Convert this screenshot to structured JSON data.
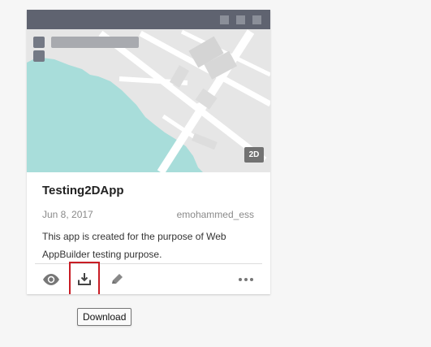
{
  "card": {
    "title": "Testing2DApp",
    "date": "Jun 8, 2017",
    "owner": "emohammed_ess",
    "description": "This app is created for the purpose of Web AppBuilder testing purpose.",
    "thumbnail": {
      "badge": "2D"
    },
    "actions": {
      "view_icon": "eye-icon",
      "download_icon": "download-icon",
      "edit_icon": "pencil-icon",
      "more_icon": "ellipsis-icon"
    }
  },
  "tooltip": {
    "text": "Download"
  },
  "colors": {
    "water": "#a9dfdc",
    "land": "#e7e7e7",
    "roads": "#ffffff",
    "header": "#5f6370",
    "highlight": "#c81d25"
  }
}
